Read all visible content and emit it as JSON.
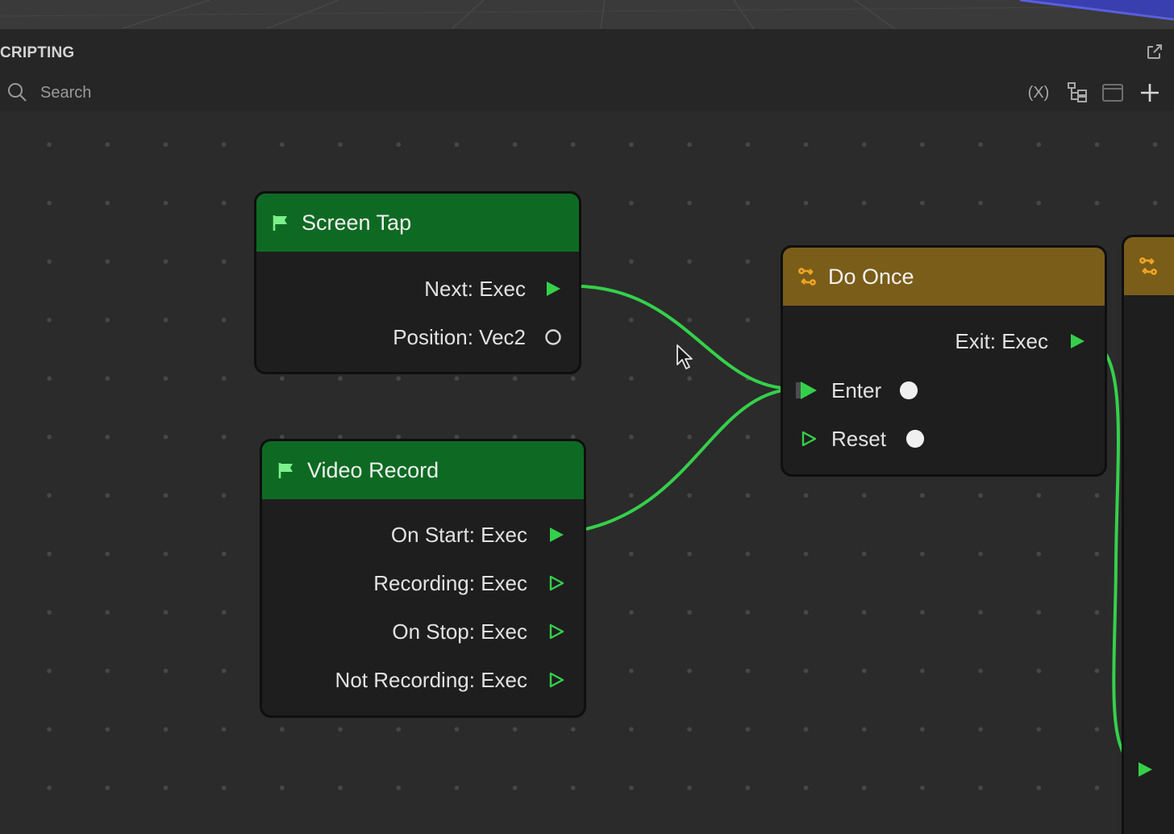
{
  "panel": {
    "title": "CRIPTING"
  },
  "search": {
    "placeholder": "Search"
  },
  "toolbar": {
    "variables_label": "(X)"
  },
  "nodes": {
    "screen_tap": {
      "title": "Screen Tap",
      "outputs": [
        "Next: Exec",
        "Position: Vec2"
      ]
    },
    "video_record": {
      "title": "Video Record",
      "outputs": [
        "On Start: Exec",
        "Recording: Exec",
        "On Stop: Exec",
        "Not Recording: Exec"
      ]
    },
    "do_once": {
      "title": "Do Once",
      "outputs": [
        "Exit: Exec"
      ],
      "inputs": [
        "Enter",
        "Reset"
      ]
    }
  },
  "colors": {
    "event_header": "#0e6a23",
    "logic_header": "#7a5d19",
    "wire": "#35d04a",
    "logic_icon": "#f2a623"
  },
  "icons": {
    "event": "flag-icon",
    "logic": "branch-icon"
  }
}
